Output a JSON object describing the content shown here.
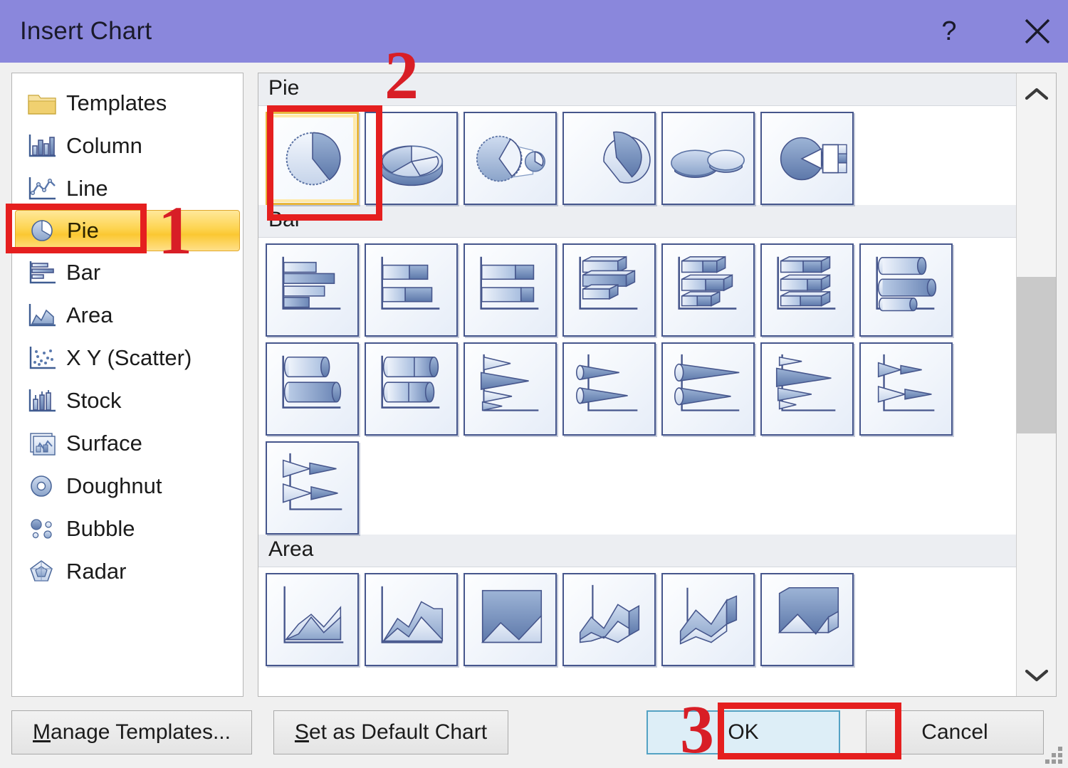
{
  "window": {
    "title": "Insert Chart",
    "help_label": "?",
    "close_label": "✕"
  },
  "sidebar": {
    "items": [
      {
        "label": "Templates",
        "icon": "folder-icon",
        "selected": false
      },
      {
        "label": "Column",
        "icon": "column-chart-icon",
        "selected": false
      },
      {
        "label": "Line",
        "icon": "line-chart-icon",
        "selected": false
      },
      {
        "label": "Pie",
        "icon": "pie-chart-icon",
        "selected": true
      },
      {
        "label": "Bar",
        "icon": "bar-chart-icon",
        "selected": false
      },
      {
        "label": "Area",
        "icon": "area-chart-icon",
        "selected": false
      },
      {
        "label": "X Y (Scatter)",
        "icon": "scatter-chart-icon",
        "selected": false
      },
      {
        "label": "Stock",
        "icon": "stock-chart-icon",
        "selected": false
      },
      {
        "label": "Surface",
        "icon": "surface-chart-icon",
        "selected": false
      },
      {
        "label": "Doughnut",
        "icon": "doughnut-chart-icon",
        "selected": false
      },
      {
        "label": "Bubble",
        "icon": "bubble-chart-icon",
        "selected": false
      },
      {
        "label": "Radar",
        "icon": "radar-chart-icon",
        "selected": false
      }
    ]
  },
  "gallery": {
    "groups": [
      {
        "name": "Pie",
        "rows": [
          [
            {
              "icon": "pie-2d-icon",
              "selected": true
            },
            {
              "icon": "pie-3d-icon",
              "selected": false
            },
            {
              "icon": "pie-of-pie-icon",
              "selected": false
            },
            {
              "icon": "exploded-pie-icon",
              "selected": false
            },
            {
              "icon": "exploded-pie-3d-icon",
              "selected": false
            },
            {
              "icon": "bar-of-pie-icon",
              "selected": false
            }
          ]
        ]
      },
      {
        "name": "Bar",
        "rows": [
          [
            {
              "icon": "clustered-bar-icon",
              "selected": false
            },
            {
              "icon": "stacked-bar-icon",
              "selected": false
            },
            {
              "icon": "100-stacked-bar-icon",
              "selected": false
            },
            {
              "icon": "clustered-bar-3d-icon",
              "selected": false
            },
            {
              "icon": "stacked-bar-3d-icon",
              "selected": false
            },
            {
              "icon": "100-stacked-bar-3d-icon",
              "selected": false
            },
            {
              "icon": "horizontal-cylinder-icon",
              "selected": false
            }
          ],
          [
            {
              "icon": "clustered-cylinder-bar-icon",
              "selected": false
            },
            {
              "icon": "stacked-cylinder-bar-icon",
              "selected": false
            },
            {
              "icon": "clustered-cone-bar-icon",
              "selected": false
            },
            {
              "icon": "stacked-cone-bar-icon",
              "selected": false
            },
            {
              "icon": "100-stacked-cone-bar-icon",
              "selected": false
            },
            {
              "icon": "clustered-pyramid-bar-icon",
              "selected": false
            },
            {
              "icon": "stacked-pyramid-bar-icon",
              "selected": false
            }
          ],
          [
            {
              "icon": "100-stacked-pyramid-bar-icon",
              "selected": false
            }
          ]
        ]
      },
      {
        "name": "Area",
        "rows": [
          [
            {
              "icon": "area-2d-icon",
              "selected": false
            },
            {
              "icon": "stacked-area-icon",
              "selected": false
            },
            {
              "icon": "100-stacked-area-icon",
              "selected": false
            },
            {
              "icon": "area-3d-icon",
              "selected": false
            },
            {
              "icon": "stacked-area-3d-icon",
              "selected": false
            },
            {
              "icon": "100-stacked-area-3d-icon",
              "selected": false
            }
          ]
        ]
      }
    ]
  },
  "scrollbar": {
    "up_label": "⌃",
    "down_label": "⌄"
  },
  "footer": {
    "manage_templates_label": "Manage Templates...",
    "manage_templates_accel": "M",
    "manage_templates_rest": "anage Templates...",
    "set_default_accel": "S",
    "set_default_rest": "et as Default Chart",
    "set_default_label": "Set as Default Chart",
    "ok_label": "OK",
    "cancel_label": "Cancel"
  },
  "annotations": {
    "step1": "1",
    "step2": "2",
    "step3": "3",
    "color": "#e51f1f"
  }
}
